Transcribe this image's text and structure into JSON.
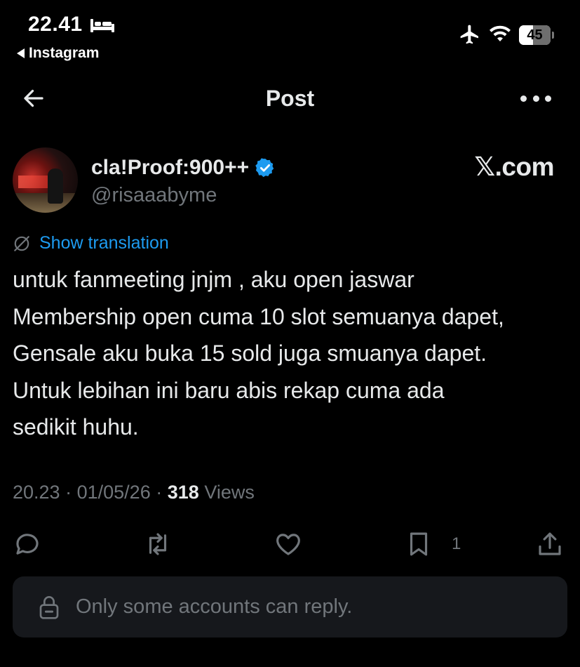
{
  "status_bar": {
    "time": "22.41",
    "back_app": "Instagram",
    "battery_level": 45,
    "battery_label": "45",
    "icons": [
      "bed-icon",
      "airplane-icon",
      "wifi-icon",
      "battery-icon"
    ]
  },
  "header": {
    "title": "Post",
    "back_icon": "back-arrow-icon",
    "more_icon": "more-icon"
  },
  "author": {
    "display_name": "cla!Proof:900++",
    "handle": "@risaaabyme",
    "verified": true,
    "verified_color": "#1d9bf0",
    "watermark": "𝕏.com"
  },
  "translate": {
    "label": "Show translation",
    "color": "#1d9bf0"
  },
  "tweet": {
    "lines": [
      "untuk fanmeeting jnjm , aku open jaswar",
      "Membership open cuma 10 slot semuanya dapet,",
      "Gensale aku buka 15 sold juga smuanya dapet.",
      "Untuk lebihan ini baru abis rekap cuma ada",
      "sedikit huhu."
    ]
  },
  "meta": {
    "time": "20.23",
    "date": "01/05/26",
    "separator": "·",
    "views_count": "318",
    "views_label": "Views"
  },
  "actions": {
    "reply_icon": "reply-icon",
    "repost_icon": "repost-icon",
    "like_icon": "heart-icon",
    "bookmark_icon": "bookmark-icon",
    "bookmark_count": "1",
    "share_icon": "share-icon"
  },
  "reply_restriction": {
    "text": "Only some accounts can reply."
  },
  "colors": {
    "background": "#000000",
    "text_primary": "#e7e9ea",
    "text_secondary": "#71767b",
    "accent": "#1d9bf0",
    "reply_box": "#16181c"
  }
}
